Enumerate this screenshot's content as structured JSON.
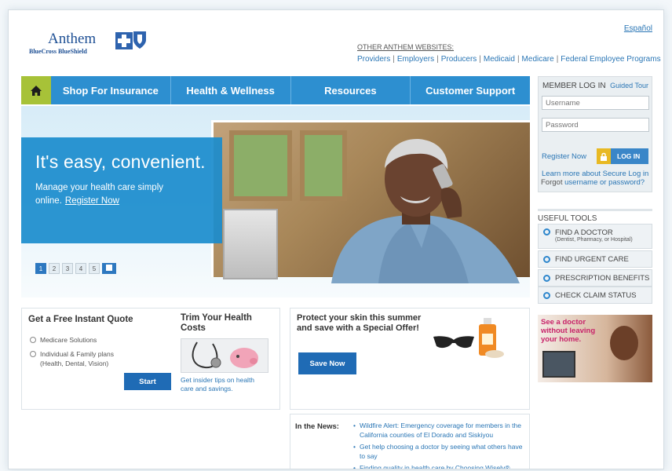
{
  "header": {
    "logo_name": "Anthem",
    "logo_sub": "BlueCross BlueShield",
    "espanol": "Español",
    "other_sites_label": "OTHER ANTHEM WEBSITES:",
    "site_links": [
      "Providers",
      "Employers",
      "Producers",
      "Medicaid",
      "Medicare",
      "Federal Employee Programs"
    ]
  },
  "nav": {
    "items": [
      "Shop For Insurance",
      "Health & Wellness",
      "Resources",
      "Customer Support"
    ]
  },
  "hero": {
    "headline": "It's easy, convenient.",
    "subline": "Manage your health care simply online.",
    "register_link": "Register Now",
    "pages": [
      "1",
      "2",
      "3",
      "4",
      "5"
    ],
    "active_page": "1"
  },
  "login": {
    "title": "MEMBER LOG IN",
    "guided_tour": "Guided Tour",
    "username_placeholder": "Username",
    "password_placeholder": "Password",
    "register": "Register Now",
    "login_button": "LOG IN",
    "learn_more": "Learn more about Secure Log in",
    "forgot_prefix": "Forgot ",
    "forgot_link": "username or password?"
  },
  "tools": {
    "title": "USEFUL TOOLS",
    "items": [
      {
        "label": "FIND A DOCTOR",
        "sub": "(Dentist, Pharmacy, or Hospital)"
      },
      {
        "label": "FIND URGENT CARE",
        "sub": ""
      },
      {
        "label": "PRESCRIPTION BENEFITS",
        "sub": ""
      },
      {
        "label": "CHECK CLAIM STATUS",
        "sub": ""
      }
    ]
  },
  "promo": {
    "text": "See a doctor without leaving your home."
  },
  "quote": {
    "title": "Get a Free Instant Quote",
    "options": [
      "Medicare Solutions",
      "Individual & Family plans (Health, Dental, Vision)"
    ],
    "start_button": "Start"
  },
  "trim": {
    "title": "Trim Your Health Costs",
    "link": "Get insider tips on health care and savings."
  },
  "protect": {
    "title": "Protect your skin this summer and save with a Special Offer!",
    "button": "Save Now"
  },
  "news": {
    "label": "In the News:",
    "items": [
      "Wildfire Alert: Emergency coverage for members in the California counties of El Dorado and Siskiyou",
      "Get help choosing a doctor by seeing what others have to say",
      "Finding quality in health care by Choosing Wisely®"
    ]
  }
}
